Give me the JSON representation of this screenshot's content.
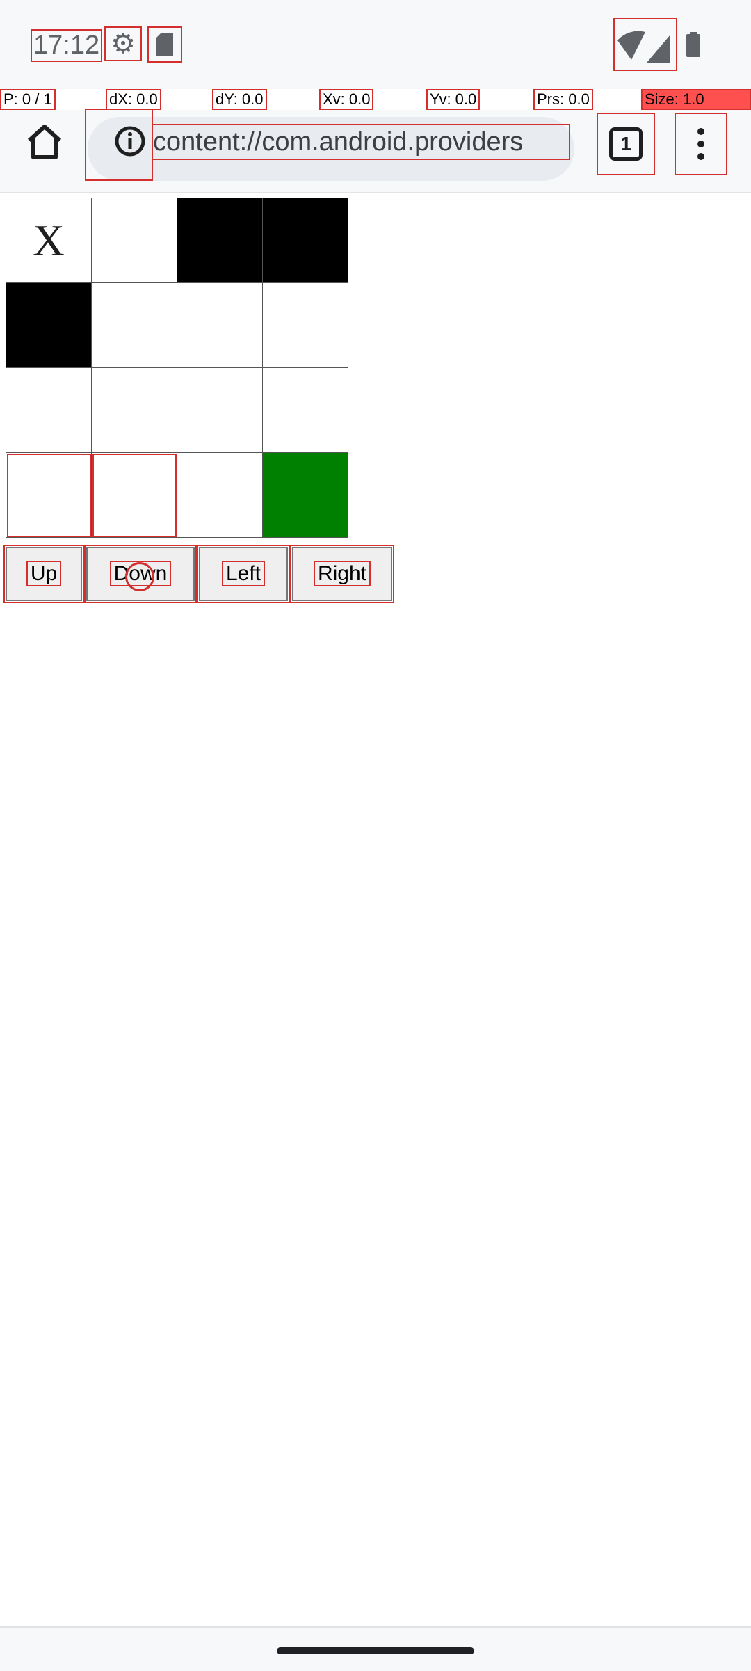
{
  "status_bar": {
    "time": "17:12",
    "icons": [
      "gear-icon",
      "sd-card-icon",
      "wifi-icon",
      "cell-signal-icon",
      "battery-icon"
    ]
  },
  "pointer_info": {
    "p": "P: 0 / 1",
    "dx": "dX: 0.0",
    "dy": "dY: 0.0",
    "xv": "Xv: 0.0",
    "yv": "Yv: 0.0",
    "prs": "Prs: 0.0",
    "size": "Size: 1.0"
  },
  "toolbar": {
    "url": "content://com.android.providers",
    "tab_count": "1"
  },
  "grid": {
    "rows": [
      [
        {
          "text": "X",
          "fill": "white"
        },
        {
          "text": "",
          "fill": "white"
        },
        {
          "text": "",
          "fill": "black"
        },
        {
          "text": "",
          "fill": "black"
        }
      ],
      [
        {
          "text": "",
          "fill": "black"
        },
        {
          "text": "",
          "fill": "white"
        },
        {
          "text": "",
          "fill": "white"
        },
        {
          "text": "",
          "fill": "white"
        }
      ],
      [
        {
          "text": "",
          "fill": "white"
        },
        {
          "text": "",
          "fill": "white"
        },
        {
          "text": "",
          "fill": "white"
        },
        {
          "text": "",
          "fill": "white"
        }
      ],
      [
        {
          "text": "",
          "fill": "white"
        },
        {
          "text": "",
          "fill": "white"
        },
        {
          "text": "",
          "fill": "white"
        },
        {
          "text": "",
          "fill": "green"
        }
      ]
    ]
  },
  "controls": {
    "up": "Up",
    "down": "Down",
    "left": "Left",
    "right": "Right"
  },
  "colors": {
    "goal": "#008000",
    "wall": "#000000",
    "highlight": "#d32f2f"
  }
}
